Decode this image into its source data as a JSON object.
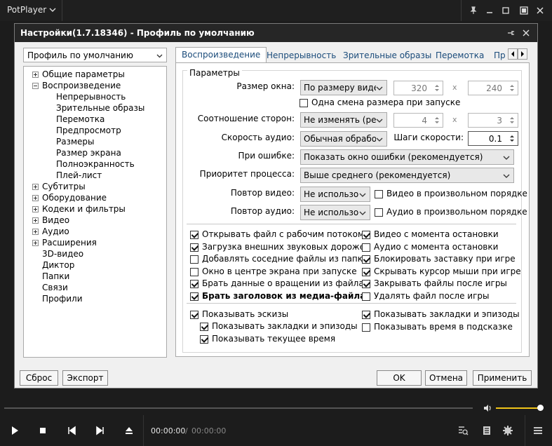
{
  "app": {
    "title": "PotPlayer"
  },
  "dialog": {
    "title": "Настройки(1.7.18346) - Профиль по умолчанию",
    "profile_select": "Профиль по умолчанию",
    "tree": [
      {
        "label": "Общие параметры",
        "expander": "plus",
        "level": 0
      },
      {
        "label": "Воспроизведение",
        "expander": "minus",
        "level": 0
      },
      {
        "label": "Непрерывность",
        "level": 1
      },
      {
        "label": "Зрительные образы",
        "level": 1
      },
      {
        "label": "Перемотка",
        "level": 1
      },
      {
        "label": "Предпросмотр",
        "level": 1
      },
      {
        "label": "Размеры",
        "level": 1
      },
      {
        "label": "Размер экрана",
        "level": 1
      },
      {
        "label": "Полноэкранность",
        "level": 1
      },
      {
        "label": "Плей-лист",
        "level": 1
      },
      {
        "label": "Субтитры",
        "expander": "plus",
        "level": 0
      },
      {
        "label": "Оборудование",
        "expander": "plus",
        "level": 0
      },
      {
        "label": "Кодеки и фильтры",
        "expander": "plus",
        "level": 0
      },
      {
        "label": "Видео",
        "expander": "plus",
        "level": 0
      },
      {
        "label": "Аудио",
        "expander": "plus",
        "level": 0
      },
      {
        "label": "Расширения",
        "expander": "plus",
        "level": 0
      },
      {
        "label": "3D-видео",
        "level": 0
      },
      {
        "label": "Диктор",
        "level": 0
      },
      {
        "label": "Папки",
        "level": 0
      },
      {
        "label": "Связи",
        "level": 0
      },
      {
        "label": "Профили",
        "level": 0
      }
    ],
    "tabs": [
      "Воспроизведение",
      "Непрерывность",
      "Зрительные образы",
      "Перемотка",
      "Пр"
    ],
    "group_title": "Параметры",
    "window_size": {
      "label": "Размер окна:",
      "value": "По размеру виде",
      "w": "320",
      "h": "240",
      "x": "x"
    },
    "one_resize": "Одна смена размера при запуске",
    "aspect": {
      "label": "Соотношение сторон:",
      "value": "Не изменять (рек",
      "w": "4",
      "h": "3",
      "x": "x"
    },
    "audio_speed": {
      "label": "Скорость аудио:",
      "value": "Обычная обработ"
    },
    "speed_step": {
      "label": "Шаги скорости:",
      "value": "0.1"
    },
    "on_error": {
      "label": "При ошибке:",
      "value": "Показать окно ошибки (рекомендуется)"
    },
    "priority": {
      "label": "Приоритет процесса:",
      "value": "Выше среднего (рекомендуется)"
    },
    "repeat_video": {
      "label": "Повтор видео:",
      "value": "Не использов",
      "random": "Видео в произвольном порядке"
    },
    "repeat_audio": {
      "label": "Повтор аудио:",
      "value": "Не использов",
      "random": "Аудио в произвольном порядке"
    },
    "checks_left": [
      {
        "label": "Открывать файл с рабочим потоком",
        "checked": true
      },
      {
        "label": "Загрузка внешних звуковых дорожек",
        "checked": true
      },
      {
        "label": "Добавлять соседние файлы из папки",
        "checked": false
      },
      {
        "label": "Окно в центре экрана при запуске",
        "checked": false
      },
      {
        "label": "Брать данные о вращении из файла",
        "checked": true
      },
      {
        "label": "Брать заголовок из медиа-файла",
        "checked": true,
        "bold": true
      }
    ],
    "checks_right": [
      {
        "label": "Видео с момента остановки",
        "checked": true
      },
      {
        "label": "Аудио с момента остановки",
        "checked": false
      },
      {
        "label": "Блокировать заставку при игре",
        "checked": true
      },
      {
        "label": "Скрывать курсор мыши при игре",
        "checked": true
      },
      {
        "label": "Закрывать файлы после игры",
        "checked": true
      },
      {
        "label": "Удалять файл после игры",
        "checked": false
      }
    ],
    "thumbs": {
      "label": "Показывать эскизы",
      "checked": true
    },
    "thumbs_sub": [
      {
        "label": "Показывать закладки и эпизоды",
        "checked": true
      },
      {
        "label": "Показывать текущее время",
        "checked": true
      }
    ],
    "thumbs_right": [
      {
        "label": "Показывать закладки и эпизоды",
        "checked": true
      },
      {
        "label": "Показывать время в подсказке",
        "checked": false
      }
    ],
    "buttons": {
      "reset": "Сброс",
      "export": "Экспорт",
      "ok": "OK",
      "cancel": "Отмена",
      "apply": "Применить"
    }
  },
  "player": {
    "time_current": "00:00:00",
    "time_sep": "/",
    "time_total": "00:00:00",
    "volume_level": 1.0
  }
}
